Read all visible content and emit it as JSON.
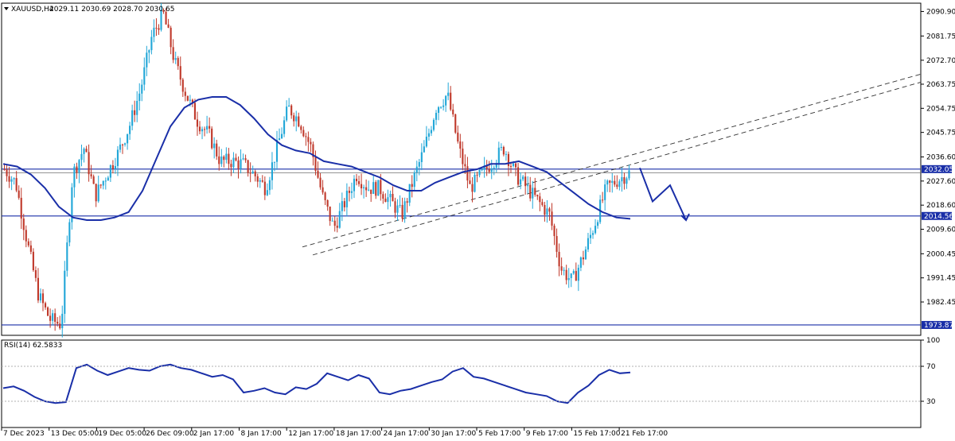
{
  "header": {
    "symbol": "XAUUSD,H4",
    "ohlc": "2029.11 2030.69 2028.70 2030.65"
  },
  "rsi_header": "RSI(14) 62.5833",
  "colors": {
    "up": "#22a7d8",
    "down": "#c0392b",
    "ma": "#1a2fa8",
    "level": "#1a2fa8",
    "grid": "#b0b0b0",
    "rsi": "#1a2fa8"
  },
  "chart_data": [
    {
      "type": "candlestick",
      "title": "XAUUSD,H4",
      "y_ticks": [
        "2090.90",
        "2081.75",
        "2072.70",
        "2063.75",
        "2054.75",
        "2045.75",
        "2036.60",
        "2027.60",
        "2018.60",
        "2009.60",
        "2000.45",
        "1991.45",
        "1982.45"
      ],
      "ylim": [
        1970,
        2094
      ],
      "x_ticks": [
        "7 Dec 2023",
        "13 Dec 05:00",
        "19 Dec 05:00",
        "26 Dec 09:00",
        "2 Jan 17:00",
        "8 Jan 17:00",
        "12 Jan 17:00",
        "18 Jan 17:00",
        "24 Jan 17:00",
        "30 Jan 17:00",
        "5 Feb 17:00",
        "9 Feb 17:00",
        "15 Feb 17:00",
        "21 Feb 17:00"
      ],
      "close_path": [
        2032,
        2027,
        2005,
        1985,
        1976,
        1974,
        2030,
        2040,
        2022,
        2030,
        2038,
        2048,
        2062,
        2082,
        2090,
        2072,
        2060,
        2050,
        2045,
        2035,
        2035,
        2034,
        2030,
        2025,
        2040,
        2055,
        2050,
        2040,
        2022,
        2010,
        2020,
        2030,
        2025,
        2025,
        2020,
        2015,
        2028,
        2040,
        2055,
        2060,
        2040,
        2025,
        2030,
        2035,
        2040,
        2030,
        2025,
        2020,
        2015,
        1995,
        1990,
        2000,
        2012,
        2025,
        2028,
        2030.65
      ],
      "moving_average": [
        2034,
        2033,
        2030,
        2025,
        2018,
        2014,
        2013,
        2013,
        2014,
        2016,
        2024,
        2036,
        2048,
        2055,
        2058,
        2059,
        2059,
        2056,
        2051,
        2045,
        2041,
        2039,
        2038,
        2035,
        2034,
        2033,
        2031,
        2029,
        2026,
        2024,
        2024,
        2027,
        2029,
        2031,
        2032,
        2034,
        2034,
        2035,
        2033,
        2031,
        2027,
        2023,
        2019,
        2016,
        2014,
        2013.5
      ],
      "horizontal_levels": [
        {
          "value": 2032.05,
          "label": "2032.05"
        },
        {
          "value": 2014.56,
          "label": "2014.56"
        },
        {
          "value": 1973.87,
          "label": "1973.87"
        }
      ],
      "projection": [
        2032.5,
        2020,
        2026,
        2013
      ]
    },
    {
      "type": "line",
      "title": "RSI(14) 62.5833",
      "y_ticks": [
        "100",
        "70",
        "30"
      ],
      "ylim": [
        0,
        100
      ],
      "values": [
        45,
        47,
        42,
        35,
        30,
        28,
        29,
        68,
        72,
        65,
        60,
        64,
        68,
        66,
        65,
        70,
        72,
        68,
        66,
        62,
        58,
        60,
        55,
        40,
        42,
        45,
        40,
        38,
        46,
        44,
        50,
        62,
        58,
        54,
        60,
        56,
        40,
        38,
        42,
        44,
        48,
        52,
        55,
        64,
        68,
        58,
        56,
        52,
        48,
        44,
        40,
        38,
        36,
        30,
        28,
        40,
        48,
        60,
        66,
        62,
        63
      ]
    }
  ]
}
